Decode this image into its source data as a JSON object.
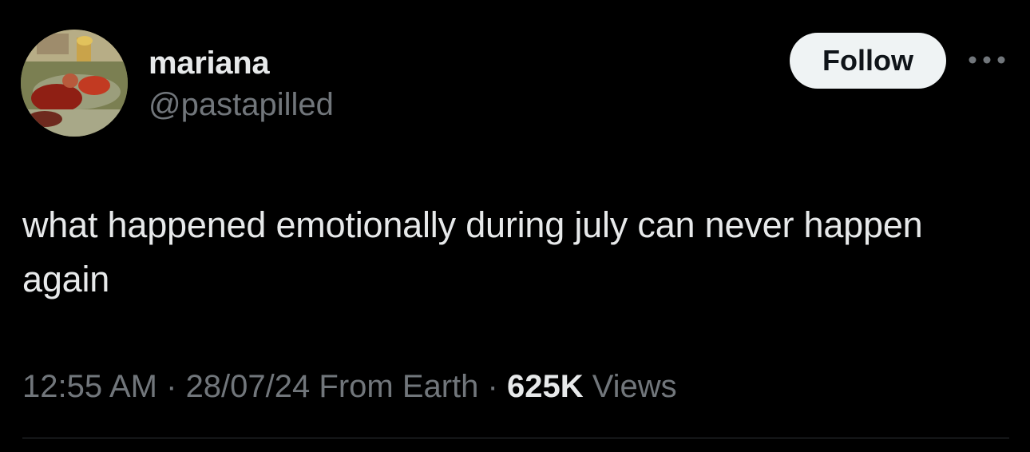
{
  "author": {
    "display_name": "mariana",
    "handle": "@pastapilled"
  },
  "actions": {
    "follow_label": "Follow"
  },
  "tweet": {
    "text": "what happened emotionally during july can never happen again"
  },
  "meta": {
    "time": "12:55 AM",
    "sep1": " · ",
    "date": "28/07/24",
    "location": " From Earth",
    "sep2": " · ",
    "views_count": "625K",
    "views_label": " Views"
  },
  "colors": {
    "background": "#000000",
    "primary_text": "#e7e9ea",
    "secondary_text": "#71767b",
    "follow_bg": "#eff3f4",
    "follow_text": "#0f1419",
    "divider": "#2f3336"
  }
}
